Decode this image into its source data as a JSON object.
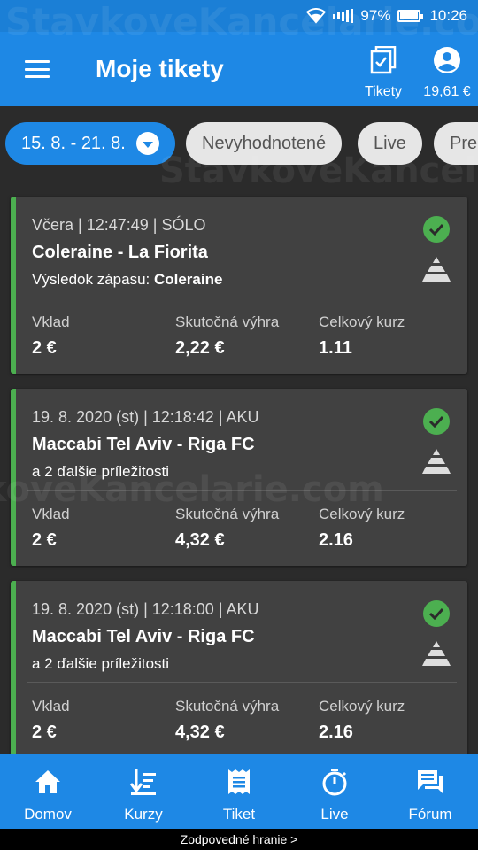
{
  "status_bar": {
    "battery": "97%",
    "battery_level": 0.97,
    "time": "10:26",
    "icons": [
      "wifi-icon",
      "signal-icon",
      "battery-icon"
    ]
  },
  "app_bar": {
    "title": "Moje tikety",
    "tikety_label": "Tikety",
    "balance": "19,61 €"
  },
  "filters": [
    {
      "label": "15. 8. - 21. 8.",
      "active": true
    },
    {
      "label": "Nevyhodnotené",
      "active": false
    },
    {
      "label": "Live",
      "active": false
    },
    {
      "label": "Pre",
      "active": false
    }
  ],
  "tickets": [
    {
      "meta": "Včera  |  12:47:49  |  SÓLO",
      "match": "Coleraine - La Fiorita",
      "sub_prefix": "Výsledok zápasu: ",
      "sub_bold": "Coleraine",
      "stake_label": "Vklad",
      "stake": "2 €",
      "win_label": "Skutočná výhra",
      "win": "2,22 €",
      "odds_label": "Celkový kurz",
      "odds": "1.11"
    },
    {
      "meta": "19. 8. 2020 (st)  |  12:18:42  |  AKU",
      "match": "Maccabi Tel Aviv - Riga FC",
      "sub_prefix": "a 2 ďalšie príležitosti",
      "sub_bold": "",
      "stake_label": "Vklad",
      "stake": "2 €",
      "win_label": "Skutočná výhra",
      "win": "4,32 €",
      "odds_label": "Celkový kurz",
      "odds": "2.16"
    },
    {
      "meta": "19. 8. 2020 (st)  |  12:18:00  |  AKU",
      "match": "Maccabi Tel Aviv - Riga FC",
      "sub_prefix": "a 2 ďalšie príležitosti",
      "sub_bold": "",
      "stake_label": "Vklad",
      "stake": "2 €",
      "win_label": "Skutočná výhra",
      "win": "4,32 €",
      "odds_label": "Celkový kurz",
      "odds": "2.16"
    }
  ],
  "bottom_nav": [
    {
      "label": "Domov",
      "icon": "home-icon"
    },
    {
      "label": "Kurzy",
      "icon": "sort-icon"
    },
    {
      "label": "Tiket",
      "icon": "receipt-icon"
    },
    {
      "label": "Live",
      "icon": "stopwatch-icon"
    },
    {
      "label": "Fórum",
      "icon": "forum-icon"
    }
  ],
  "footer": "Zodpovedné hranie >",
  "watermark": "StavkoveKancelarie.com",
  "colors": {
    "primary": "#1e88e5",
    "status_bar": "#1b7fd6",
    "background": "#2b2b2b",
    "card": "#414141",
    "win_accent": "#4caf50"
  }
}
